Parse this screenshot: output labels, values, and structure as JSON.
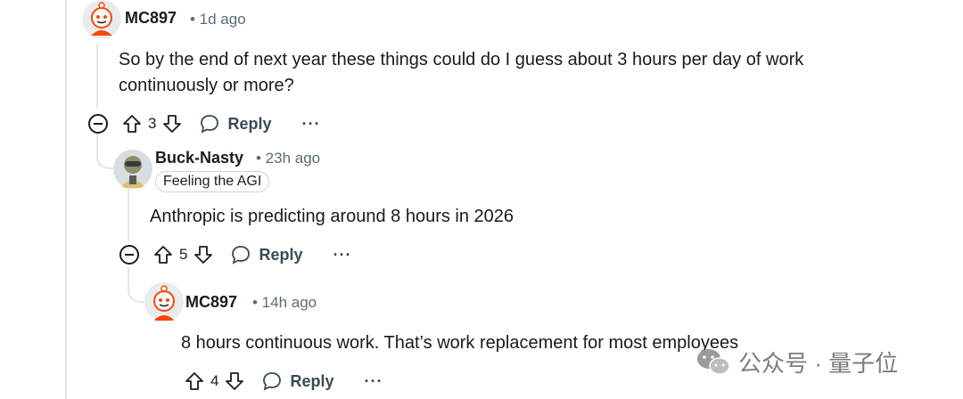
{
  "comments": [
    {
      "username": "MC897",
      "meta": "• 1d ago",
      "body_lines": [
        "So by the end of next year these things could do I guess about 3 hours per day of work",
        "continuously or more?"
      ],
      "votes": "3",
      "reply_label": "Reply",
      "more_label": "···"
    },
    {
      "username": "Buck-Nasty",
      "meta": "• 23h ago",
      "flair": "Feeling the AGI",
      "body_lines": [
        "Anthropic is predicting around 8 hours in 2026"
      ],
      "votes": "5",
      "reply_label": "Reply",
      "more_label": "···"
    },
    {
      "username": "MC897",
      "meta": "• 14h ago",
      "body_lines": [
        "8 hours continuous work. That’s work replacement for most employees"
      ],
      "votes": "4",
      "reply_label": "Reply",
      "more_label": "···"
    }
  ],
  "watermark": {
    "text": "公众号 · 量子位",
    "icon": "wechat-icon"
  },
  "colors": {
    "thread_line": "#e3e6e8",
    "meta_text": "#5c6c74",
    "avatar_orange": "#ff4500"
  }
}
